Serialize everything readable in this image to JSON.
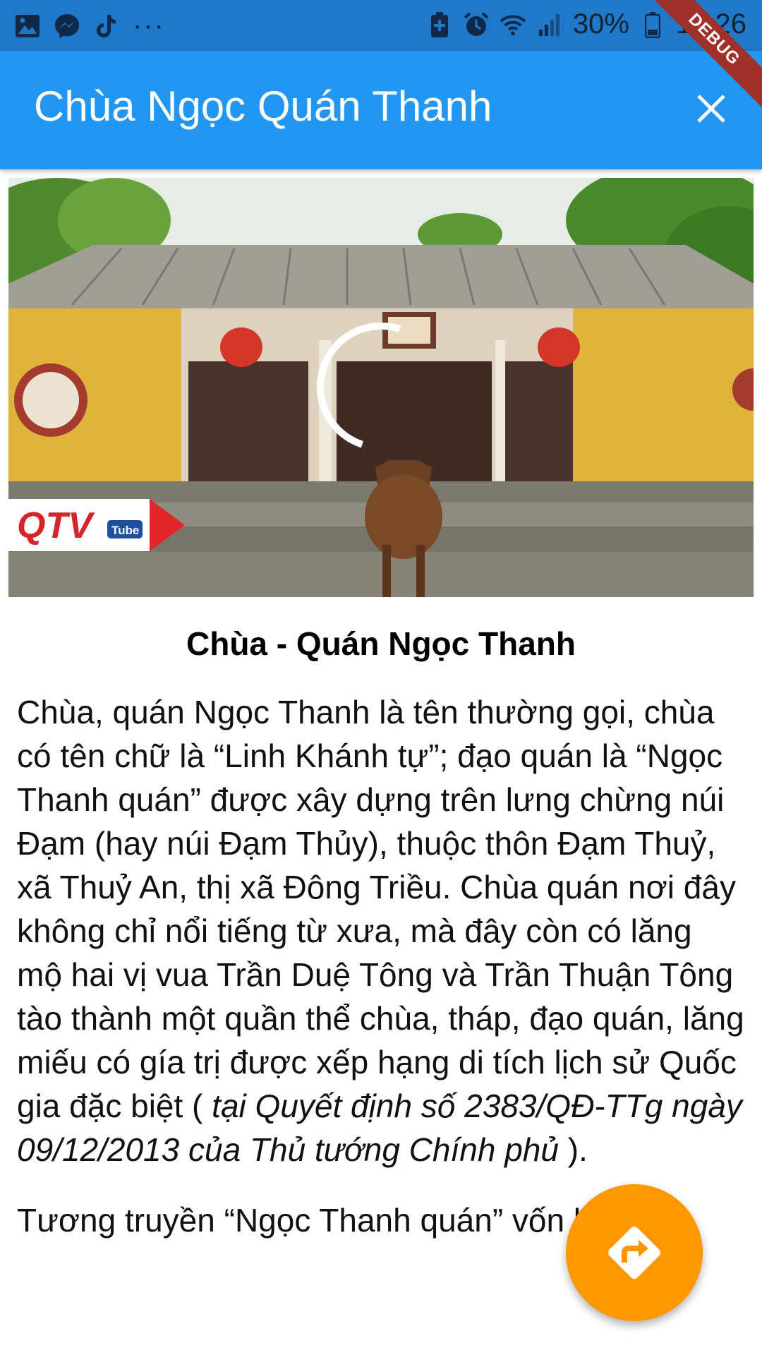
{
  "status_bar": {
    "battery": "30%",
    "time": "16:26",
    "icons": [
      "image-icon",
      "messenger-icon",
      "tiktok-icon",
      "more-notifications-icon",
      "battery-saver-icon",
      "alarm-icon",
      "wifi-icon",
      "signal-icon",
      "battery-icon"
    ]
  },
  "app_bar": {
    "title": "Chùa Ngọc Quán Thanh",
    "close_icon": "close-icon",
    "color": "#2196f3"
  },
  "debug_banner": "DEBUG",
  "video": {
    "logo_text": "QTV",
    "logo_sub": "Tube",
    "state": "loading"
  },
  "article": {
    "heading": "Chùa - Quán Ngọc Thanh",
    "p1_text": "Chùa, quán Ngọc Thanh là tên thường gọi, chùa có tên chữ là “Linh Khánh tự”; đạo quán là “Ngọc Thanh quán” được xây dựng trên lưng chừng núi Đạm (hay núi Đạm Thủy), thuộc thôn Đạm Thuỷ, xã Thuỷ An, thị xã Đông Triều. Chùa quán nơi đây không chỉ nổi tiếng từ xưa, mà đây còn có lăng mộ hai vị vua Trần Duệ Tông và Trần Thuận Tông tào thành một quần thể chùa, tháp, đạo quán, lăng miếu có gía trị được xếp hạng di tích lịch sử Quốc gia đặc biệt ( ",
    "p1_italic": "tại Quyết định số 2383/QĐ-TTg ngày 09/12/2013 của Thủ tướng Chính phủ",
    "p1_end": " ).",
    "p2_text": "Tương truyền “Ngọc Thanh quán” vốn là"
  },
  "fab": {
    "icon": "directions-icon",
    "color": "#ff9800"
  }
}
